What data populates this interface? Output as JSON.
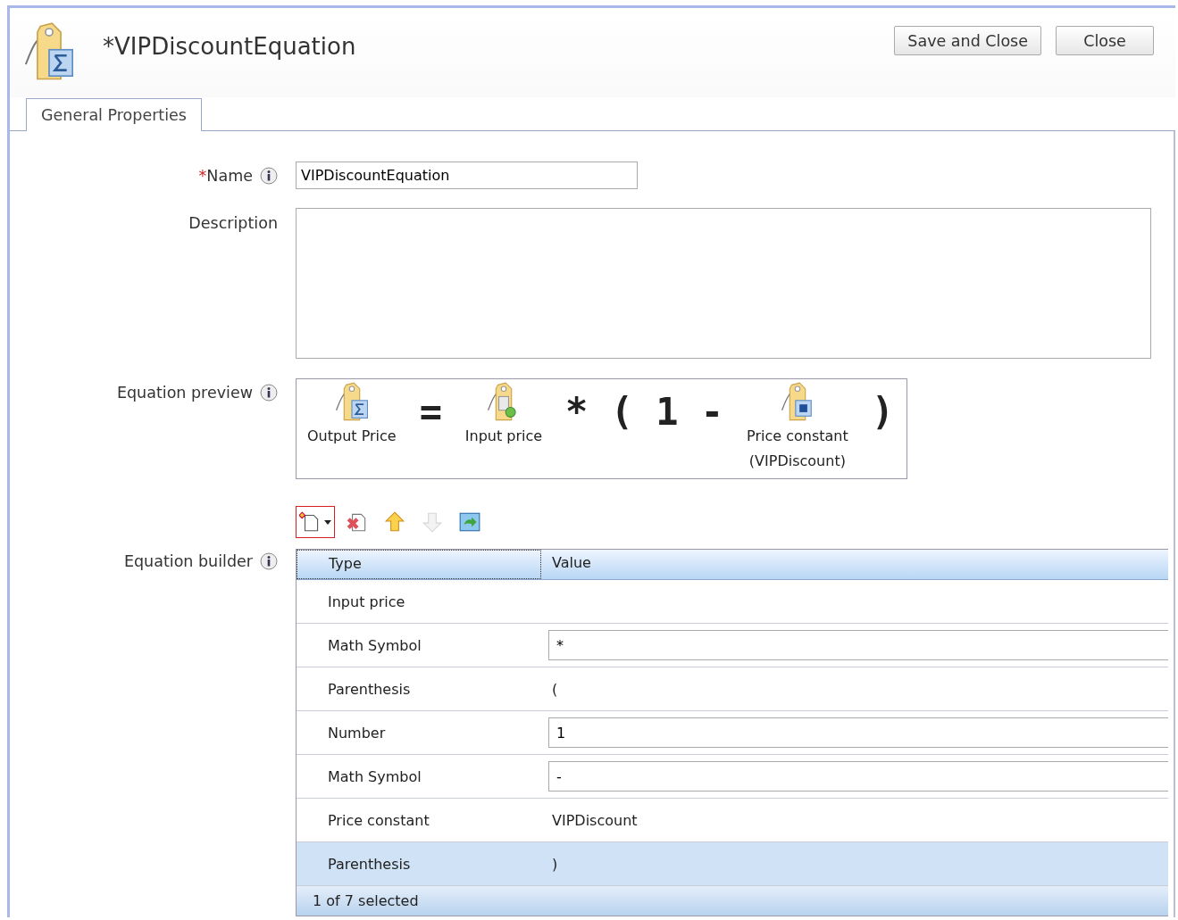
{
  "window": {
    "title": "*VIPDiscountEquation"
  },
  "buttons": [
    {
      "label": "Save and Close"
    },
    {
      "label": "Close"
    }
  ],
  "tabs": [
    {
      "label": "General Properties",
      "selected": true
    }
  ],
  "form": {
    "name": {
      "label": "Name",
      "required": true,
      "value": "VIPDiscountEquation"
    },
    "description": {
      "label": "Description"
    },
    "preview": {
      "label": "Equation preview",
      "items": [
        {
          "kind": "output",
          "label": "Output Price"
        },
        {
          "kind": "symbol",
          "text": "="
        },
        {
          "kind": "input",
          "label": "Input price"
        },
        {
          "kind": "symbol",
          "text": "* ( 1 -"
        },
        {
          "kind": "constant",
          "label": "Price constant",
          "sublabel": "(VIPDiscount)"
        },
        {
          "kind": "symbol",
          "text": ")"
        }
      ]
    },
    "builder": {
      "label": "Equation builder",
      "toolbar": [
        {
          "kind": "add",
          "disabled": false,
          "focused": true
        },
        {
          "kind": "remove",
          "disabled": false,
          "focused": false
        },
        {
          "kind": "up",
          "disabled": false,
          "focused": false
        },
        {
          "kind": "down",
          "disabled": true,
          "focused": false
        },
        {
          "kind": "export",
          "disabled": false,
          "focused": false
        }
      ],
      "columns": [
        "Type",
        "Value"
      ],
      "rows": [
        {
          "type": "Input price",
          "kind": "text",
          "selected": false
        },
        {
          "type": "Math Symbol",
          "kind": "field",
          "value": "*",
          "selected": false
        },
        {
          "type": "Parenthesis",
          "kind": "text",
          "value": "(",
          "selected": false
        },
        {
          "type": "Number",
          "kind": "field",
          "value": "1",
          "selected": false
        },
        {
          "type": "Math Symbol",
          "kind": "field",
          "value": "-",
          "selected": false
        },
        {
          "type": "Price constant",
          "kind": "text",
          "value": "VIPDiscount",
          "selected": false
        },
        {
          "type": "Parenthesis",
          "kind": "text",
          "value": ")",
          "selected": true
        }
      ],
      "status": "1 of 7 selected"
    }
  }
}
